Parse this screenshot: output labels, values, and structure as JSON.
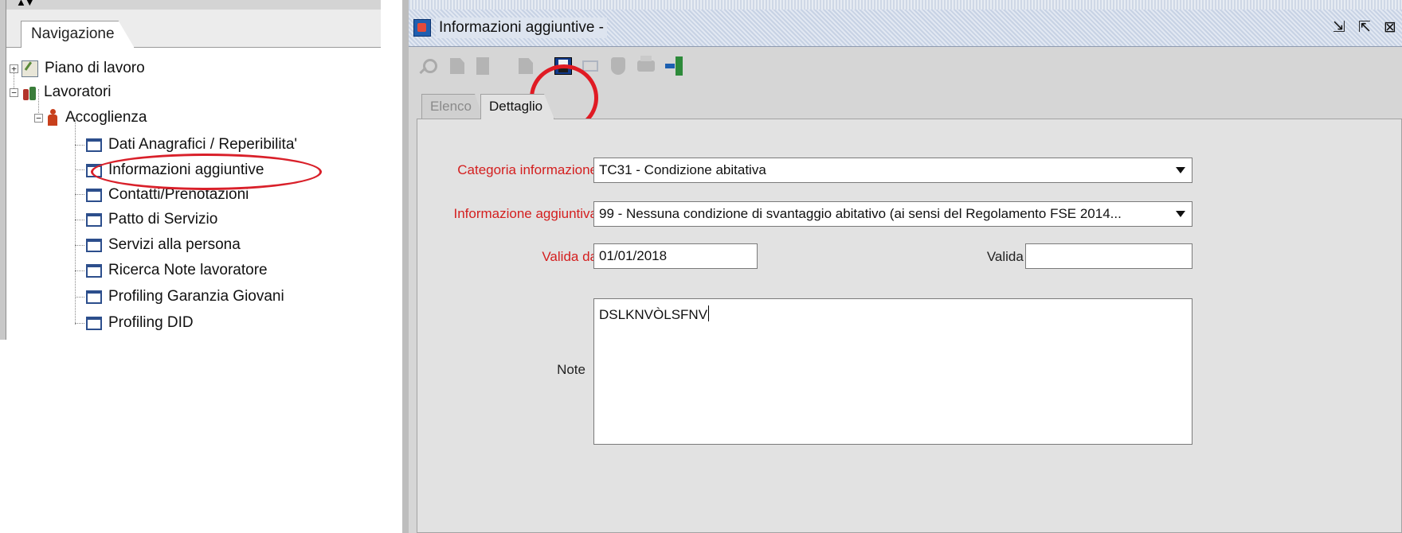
{
  "navigation": {
    "tab_label": "Navigazione",
    "tree": {
      "piano_di_lavoro": "Piano di lavoro",
      "lavoratori": "Lavoratori",
      "accoglienza": "Accoglienza",
      "items": [
        "Dati Anagrafici / Reperibilita'",
        "Informazioni aggiuntive",
        "Contatti/Prenotazioni",
        "Patto di Servizio",
        "Servizi alla persona",
        "Ricerca Note lavoratore",
        "Profiling Garanzia Giovani",
        "Profiling DID"
      ]
    }
  },
  "window": {
    "title": "Informazioni aggiuntive -",
    "controls": {
      "restore": "⇲",
      "maximize": "⇱",
      "close": "⊠"
    },
    "toolbar": {
      "icons": [
        "search-icon",
        "edit-icon",
        "document-icon",
        "copy-icon",
        "save-icon",
        "mail-icon",
        "shield-icon",
        "printer-icon",
        "exit-icon"
      ],
      "highlight_color": "#e01b24"
    },
    "tabs": {
      "elenco": "Elenco",
      "dettaglio": "Dettaglio",
      "active": "Dettaglio"
    }
  },
  "form": {
    "categoria_label": "Categoria informazione",
    "categoria_value": "TC31 - Condizione abitativa",
    "informazione_label": "Informazione aggiuntiva",
    "informazione_value": "99 - Nessuna condizione di svantaggio abitativo (ai sensi del Regolamento FSE 2014...",
    "valida_da_label": "Valida da",
    "valida_da_value": "01/01/2018",
    "valida_a_label": "Valida a",
    "valida_a_value": "",
    "note_label": "Note",
    "note_value": "DSLKNVÒLSFNV"
  },
  "colors": {
    "required_label": "#d41f1f",
    "annotation_red": "#e01b24",
    "panel_bg": "#e2e2e2"
  }
}
